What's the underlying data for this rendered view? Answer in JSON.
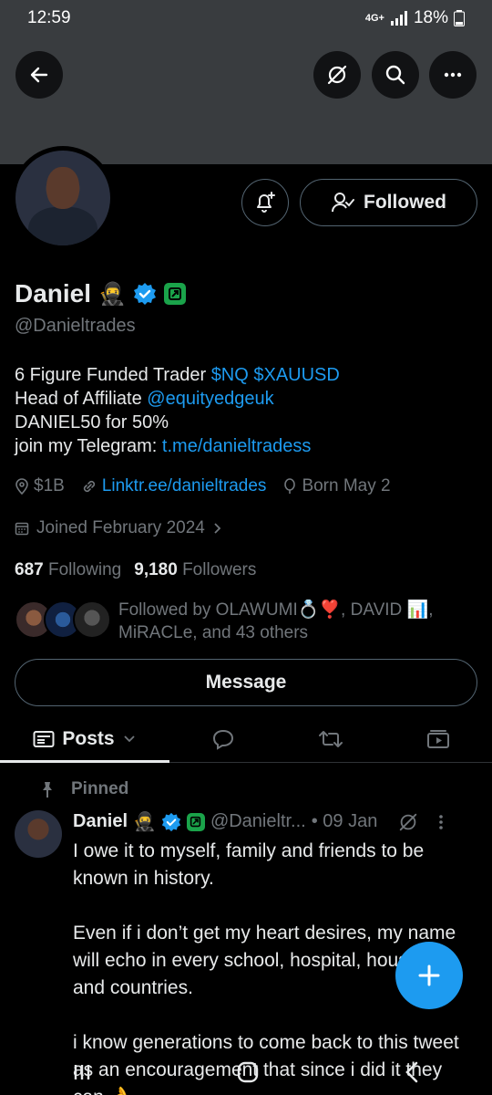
{
  "status": {
    "time": "12:59",
    "network": "4G+",
    "battery": "18%"
  },
  "profile": {
    "name": "Daniel",
    "name_emoji": "🥷",
    "handle": "@Danieltrades",
    "followed_label": "Followed",
    "bio": {
      "line1_text": "6 Figure Funded Trader ",
      "line1_link": "$NQ $XAUUSD",
      "line2_text": "Head of Affiliate ",
      "line2_link": "@equityedgeuk",
      "line3_text": "DANIEL50 for 50%",
      "line4_text": "join my Telegram: ",
      "line4_link": "t.me/danieltradess"
    },
    "location": "$1B",
    "website": "Linktr.ee/danieltrades",
    "birthday": "Born May 2",
    "joined": "Joined February 2024",
    "following_count": "687",
    "following_label": "Following",
    "followers_count": "9,180",
    "followers_label": "Followers",
    "followed_by_line1": "Followed by OLAWUMI💍❣️, DAVID 📊,",
    "followed_by_line2": "MiRACLe, and 43 others",
    "message_label": "Message"
  },
  "tabs": {
    "posts_label": "Posts"
  },
  "post": {
    "pinned_label": "Pinned",
    "author_name": "Daniel",
    "author_emoji": "🥷",
    "author_handle": "@Danieltr...",
    "date": "• 09 Jan",
    "paragraph1": "I owe it to myself, family and friends to be known in history.",
    "paragraph2": "Even if i don’t get my heart desires, my name will echo in every school, hospital, household and countries.",
    "paragraph3": "i know generations to come back to this tweet as an encouragement that since i did it they can 👌"
  },
  "colors": {
    "accent": "#1d9bf0",
    "banner": "#393c3f",
    "muted": "#71767b",
    "badge_green": "#1aa34a"
  }
}
